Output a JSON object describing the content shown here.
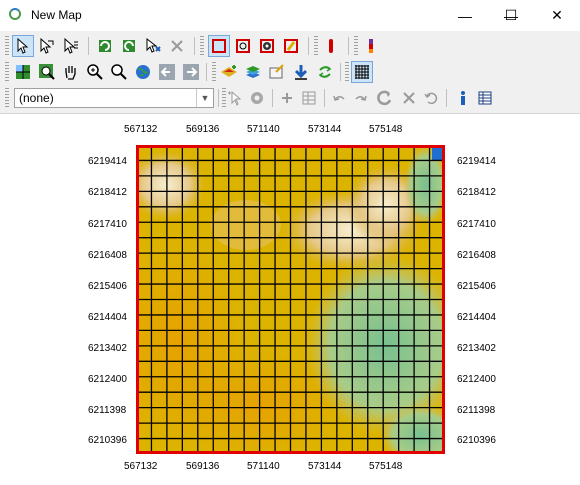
{
  "window": {
    "title": "New Map",
    "minimize_icon": "minimize-icon",
    "maximize_icon": "maximize-icon",
    "close_icon": "close-icon",
    "minimize_glyph": "—",
    "maximize_glyph": "☐",
    "close_glyph": "✕"
  },
  "toolbar": {
    "layer_select": {
      "value": "(none)"
    },
    "row1_icons": [
      "select-arrow-icon",
      "select-polygon-icon",
      "select-text-icon",
      "rotate-left-icon",
      "rotate-right-icon",
      "move-feature-icon",
      "delete-icon",
      "rectangle-frame-icon",
      "zoom-frame-icon",
      "gear-frame-icon",
      "edit-frame-icon",
      "red-marker-icon",
      "color-bar-icon"
    ],
    "row2_icons": [
      "pan-grid-icon",
      "zoom-extent-icon",
      "hand-pan-icon",
      "zoom-in-icon",
      "zoom-out-icon",
      "globe-icon",
      "back-arrow-icon",
      "forward-arrow-icon",
      "add-layer-icon",
      "layers-icon",
      "properties-icon",
      "download-icon",
      "refresh-icon",
      "grid-overlay-icon"
    ],
    "row3_icons": [
      "select-point-icon",
      "settings-icon",
      "add-icon",
      "table-icon",
      "undo-icon",
      "redo-icon",
      "reload-icon",
      "close-x-icon",
      "restore-icon",
      "info-icon",
      "attribute-table-icon"
    ]
  },
  "map": {
    "x_ticks": [
      "567132",
      "569136",
      "571140",
      "573144",
      "575148"
    ],
    "y_ticks": [
      "6219414",
      "6218412",
      "6217410",
      "6216408",
      "6215406",
      "6214404",
      "6213402",
      "6212400",
      "6211398",
      "6210396"
    ],
    "grid": {
      "columns": 20,
      "rows": 20
    },
    "colors": {
      "frame": "#e00000",
      "grid_line": "#000000",
      "terrain_low": "#e8a800",
      "terrain_mid": "#d4b400",
      "terrain_high": "#f2e6b8",
      "valley_green": "#7cc08c",
      "water_blue": "#1f6fd1"
    }
  }
}
